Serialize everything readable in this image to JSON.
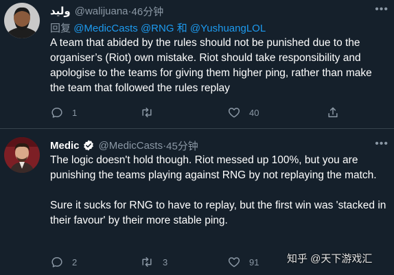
{
  "tweets": [
    {
      "display_name": "وليد",
      "handle": "@walijuana",
      "time": "46分钟",
      "replying_prefix": "回复",
      "replying_to": [
        "@MedicCasts",
        "@RNG",
        "@YushuangLOL"
      ],
      "replying_joiner": "和",
      "paragraphs": [
        "A team that abided by the rules should not be punished due to the organiser’s (Riot) own mistake. Riot should take responsibility and apologise to the teams for giving them higher ping, rather than make the team that followed the rules replay"
      ],
      "reply_count": "1",
      "retweet_count": "",
      "like_count": "40",
      "more_icon": "ellipsis-icon"
    },
    {
      "display_name": "Medic",
      "verified": true,
      "handle": "@MedicCasts",
      "time": "45分钟",
      "paragraphs": [
        "The logic doesn't hold though. Riot messed up 100%, but you are punishing the teams playing against RNG by not replaying the match.",
        "Sure it sucks for RNG to have to replay, but the first win was 'stacked in their favour' by their more stable ping."
      ],
      "reply_count": "2",
      "retweet_count": "3",
      "like_count": "91",
      "more_icon": "ellipsis-icon"
    }
  ],
  "separator": " · ",
  "watermark": "知乎 @天下游戏汇",
  "colors": {
    "background": "#15202b",
    "secondary_text": "#8b98a5",
    "link": "#1d9bf0",
    "divider": "#38444d",
    "verified_badge": "#ffffff"
  }
}
